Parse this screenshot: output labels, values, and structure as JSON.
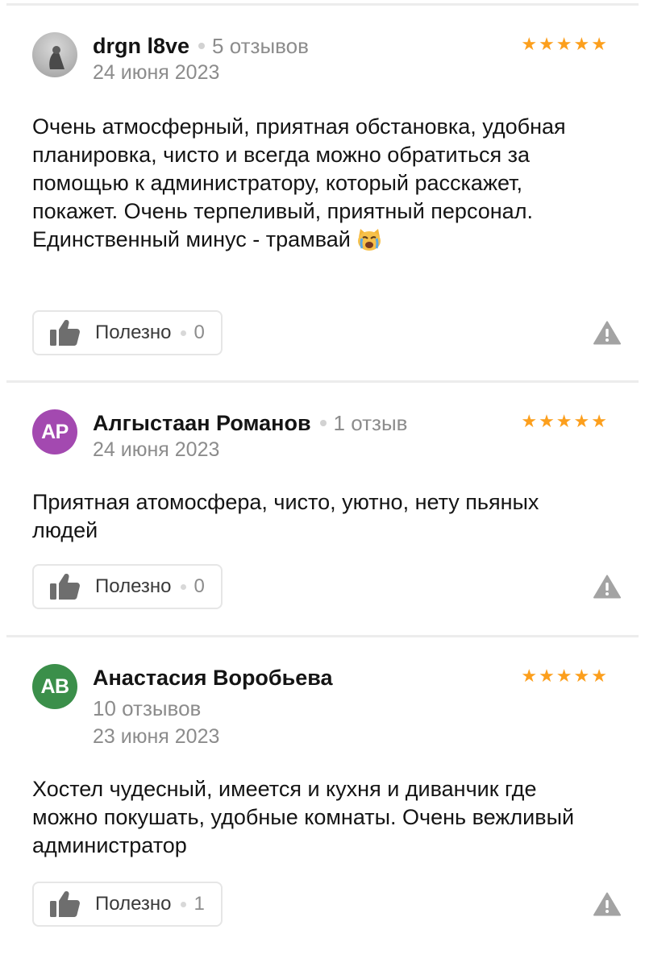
{
  "reviews": [
    {
      "author": "drgn l8ve",
      "reviews_count": "5 отзывов",
      "date": "24 июня 2023",
      "stars": 5,
      "text": "Очень атмосферный, приятная обстановка, удобная планировка, чисто и всегда можно обратиться за помощью к администратору, который расскажет, покажет. Очень терпеливый, приятный персонал. Единственный минус - трамвай",
      "useful_label": "Полезно",
      "useful_count": "0",
      "avatar_type": "photo"
    },
    {
      "author": "Алгыстаан Романов",
      "reviews_count": "1 отзыв",
      "date": "24 июня 2023",
      "stars": 5,
      "text": "Приятная атомосфера, чисто, уютно, нету пьяных людей",
      "useful_label": "Полезно",
      "useful_count": "0",
      "avatar_initials": "AP",
      "avatar_color": "#a349b0"
    },
    {
      "author": "Анастасия Воробьева",
      "reviews_count": "10 отзывов",
      "date": "23 июня 2023",
      "stars": 5,
      "text": "Хостел чудесный, имеется и кухня и диванчик где можно покушать, удобные комнаты. Очень вежливый администратор",
      "useful_label": "Полезно",
      "useful_count": "1",
      "avatar_initials": "AB",
      "avatar_color": "#3b8f4a"
    }
  ],
  "colors": {
    "star": "#fc9f1d",
    "muted_text": "#8c8c8c",
    "divider": "#ececec"
  },
  "icons": {
    "useful": "thumbs-up-icon",
    "report": "warning-icon",
    "rating": "star-icon",
    "emoji": "crying-cat-emoji"
  }
}
